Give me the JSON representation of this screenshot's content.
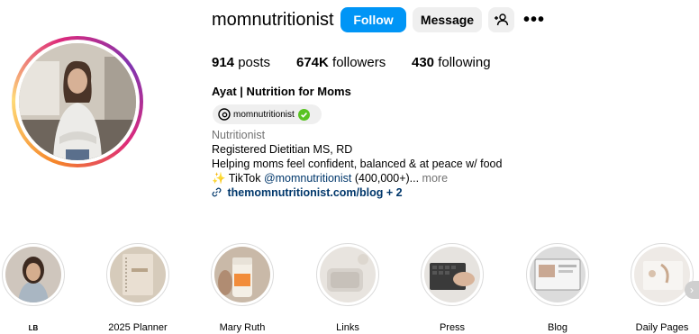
{
  "profile": {
    "username": "momnutritionist",
    "follow_label": "Follow",
    "message_label": "Message",
    "more_label": "•••"
  },
  "stats": {
    "posts_count": "914",
    "posts_label": "posts",
    "followers_count": "674K",
    "followers_label": "followers",
    "following_count": "430",
    "following_label": "following"
  },
  "bio": {
    "full_name": "Ayat | Nutrition for Moms",
    "threads_handle": "momnutritionist",
    "category": "Nutritionist",
    "line1": "Registered Dietitian MS, RD",
    "line2": "Helping moms feel confident, balanced & at peace w/ food",
    "tiktok_prefix": "✨ TikTok ",
    "tiktok_handle": "@momnutritionist",
    "tiktok_suffix": " (400,000+)...",
    "more_label": " more",
    "link_text": "themomnutritionist.com/blog + 2"
  },
  "highlights": [
    {
      "label": "LB"
    },
    {
      "label": "2025 Planner"
    },
    {
      "label": "Mary Ruth"
    },
    {
      "label": "Links"
    },
    {
      "label": "Press"
    },
    {
      "label": "Blog"
    },
    {
      "label": "Daily Pages"
    }
  ],
  "colors": {
    "follow_button": "#0095f6",
    "secondary_button": "#efefef",
    "link": "#00376b",
    "muted": "#737373",
    "verified": "#58c322"
  },
  "icons": {
    "add_user": "person-plus-icon",
    "more": "more-horizontal-icon",
    "threads": "threads-icon",
    "verified": "verified-check-icon",
    "link": "link-icon",
    "next": "chevron-right-icon"
  }
}
